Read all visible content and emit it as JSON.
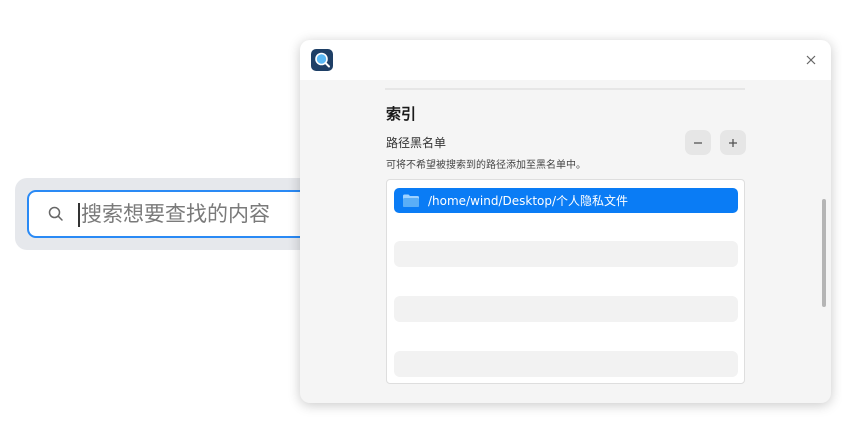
{
  "search": {
    "placeholder": "搜索想要查找的内容",
    "icon": "search-icon"
  },
  "dialog": {
    "app_icon": "search-app-icon",
    "close_icon": "close-icon",
    "section_title": "索引",
    "blacklist": {
      "label": "路径黑名单",
      "description": "可将不希望被搜索到的路径添加至黑名单中。",
      "remove_icon": "minus-icon",
      "add_icon": "plus-icon",
      "items": [
        {
          "path": "/home/wind/Desktop/个人隐私文件",
          "icon": "folder-icon",
          "selected": true
        }
      ]
    }
  },
  "colors": {
    "accent": "#0a7cf5",
    "focus_border": "#2a8af5",
    "app_icon_bg": "#1e3f66"
  }
}
